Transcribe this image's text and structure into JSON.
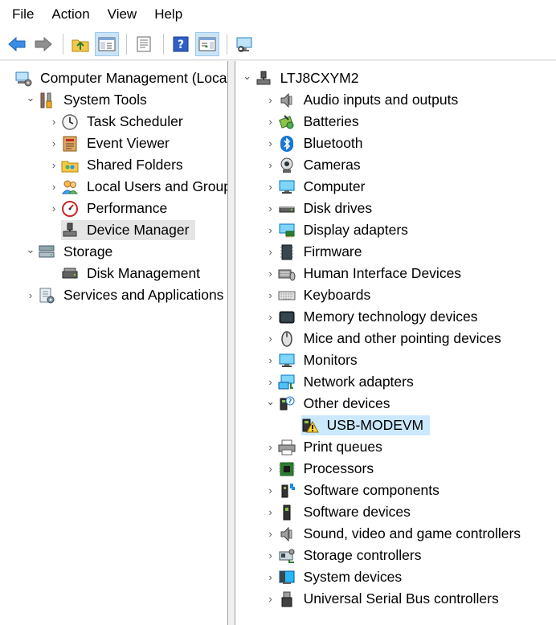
{
  "menu": [
    "File",
    "Action",
    "View",
    "Help"
  ],
  "left_tree": [
    {
      "label": "Computer Management (Local)",
      "icon": "computer-management-icon",
      "depth": 0,
      "expander": "none"
    },
    {
      "label": "System Tools",
      "icon": "tools-icon",
      "depth": 1,
      "expander": "expanded"
    },
    {
      "label": "Task Scheduler",
      "icon": "clock-icon",
      "depth": 2,
      "expander": "collapsed"
    },
    {
      "label": "Event Viewer",
      "icon": "event-viewer-icon",
      "depth": 2,
      "expander": "collapsed"
    },
    {
      "label": "Shared Folders",
      "icon": "shared-folder-icon",
      "depth": 2,
      "expander": "collapsed"
    },
    {
      "label": "Local Users and Groups",
      "icon": "users-icon",
      "depth": 2,
      "expander": "collapsed"
    },
    {
      "label": "Performance",
      "icon": "performance-icon",
      "depth": 2,
      "expander": "collapsed"
    },
    {
      "label": "Device Manager",
      "icon": "device-manager-icon",
      "depth": 2,
      "expander": "none",
      "selected": true
    },
    {
      "label": "Storage",
      "icon": "storage-icon",
      "depth": 1,
      "expander": "expanded"
    },
    {
      "label": "Disk Management",
      "icon": "disk-management-icon",
      "depth": 2,
      "expander": "none"
    },
    {
      "label": "Services and Applications",
      "icon": "services-icon",
      "depth": 1,
      "expander": "collapsed"
    }
  ],
  "right_tree": [
    {
      "label": "LTJ8CXYM2",
      "icon": "computer-root-icon",
      "depth": 0,
      "expander": "expanded"
    },
    {
      "label": "Audio inputs and outputs",
      "icon": "speaker-icon",
      "depth": 1,
      "expander": "collapsed"
    },
    {
      "label": "Batteries",
      "icon": "battery-icon",
      "depth": 1,
      "expander": "collapsed"
    },
    {
      "label": "Bluetooth",
      "icon": "bluetooth-icon",
      "depth": 1,
      "expander": "collapsed"
    },
    {
      "label": "Cameras",
      "icon": "camera-icon",
      "depth": 1,
      "expander": "collapsed"
    },
    {
      "label": "Computer",
      "icon": "monitor-icon",
      "depth": 1,
      "expander": "collapsed"
    },
    {
      "label": "Disk drives",
      "icon": "disk-drive-icon",
      "depth": 1,
      "expander": "collapsed"
    },
    {
      "label": "Display adapters",
      "icon": "display-adapter-icon",
      "depth": 1,
      "expander": "collapsed"
    },
    {
      "label": "Firmware",
      "icon": "firmware-icon",
      "depth": 1,
      "expander": "collapsed"
    },
    {
      "label": "Human Interface Devices",
      "icon": "hid-icon",
      "depth": 1,
      "expander": "collapsed"
    },
    {
      "label": "Keyboards",
      "icon": "keyboard-icon",
      "depth": 1,
      "expander": "collapsed"
    },
    {
      "label": "Memory technology devices",
      "icon": "memory-icon",
      "depth": 1,
      "expander": "collapsed"
    },
    {
      "label": "Mice and other pointing devices",
      "icon": "mouse-icon",
      "depth": 1,
      "expander": "collapsed"
    },
    {
      "label": "Monitors",
      "icon": "monitor-icon",
      "depth": 1,
      "expander": "collapsed"
    },
    {
      "label": "Network adapters",
      "icon": "network-icon",
      "depth": 1,
      "expander": "collapsed"
    },
    {
      "label": "Other devices",
      "icon": "unknown-device-icon",
      "depth": 1,
      "expander": "expanded"
    },
    {
      "label": "USB-MODEVM",
      "icon": "warning-device-icon",
      "depth": 2,
      "expander": "none",
      "selected": true
    },
    {
      "label": "Print queues",
      "icon": "printer-icon",
      "depth": 1,
      "expander": "collapsed"
    },
    {
      "label": "Processors",
      "icon": "processor-icon",
      "depth": 1,
      "expander": "collapsed"
    },
    {
      "label": "Software components",
      "icon": "software-component-icon",
      "depth": 1,
      "expander": "collapsed"
    },
    {
      "label": "Software devices",
      "icon": "software-device-icon",
      "depth": 1,
      "expander": "collapsed"
    },
    {
      "label": "Sound, video and game controllers",
      "icon": "speaker-icon",
      "depth": 1,
      "expander": "collapsed"
    },
    {
      "label": "Storage controllers",
      "icon": "storage-controller-icon",
      "depth": 1,
      "expander": "collapsed"
    },
    {
      "label": "System devices",
      "icon": "system-devices-icon",
      "depth": 1,
      "expander": "collapsed"
    },
    {
      "label": "Universal Serial Bus controllers",
      "icon": "usb-icon",
      "depth": 1,
      "expander": "collapsed"
    }
  ]
}
